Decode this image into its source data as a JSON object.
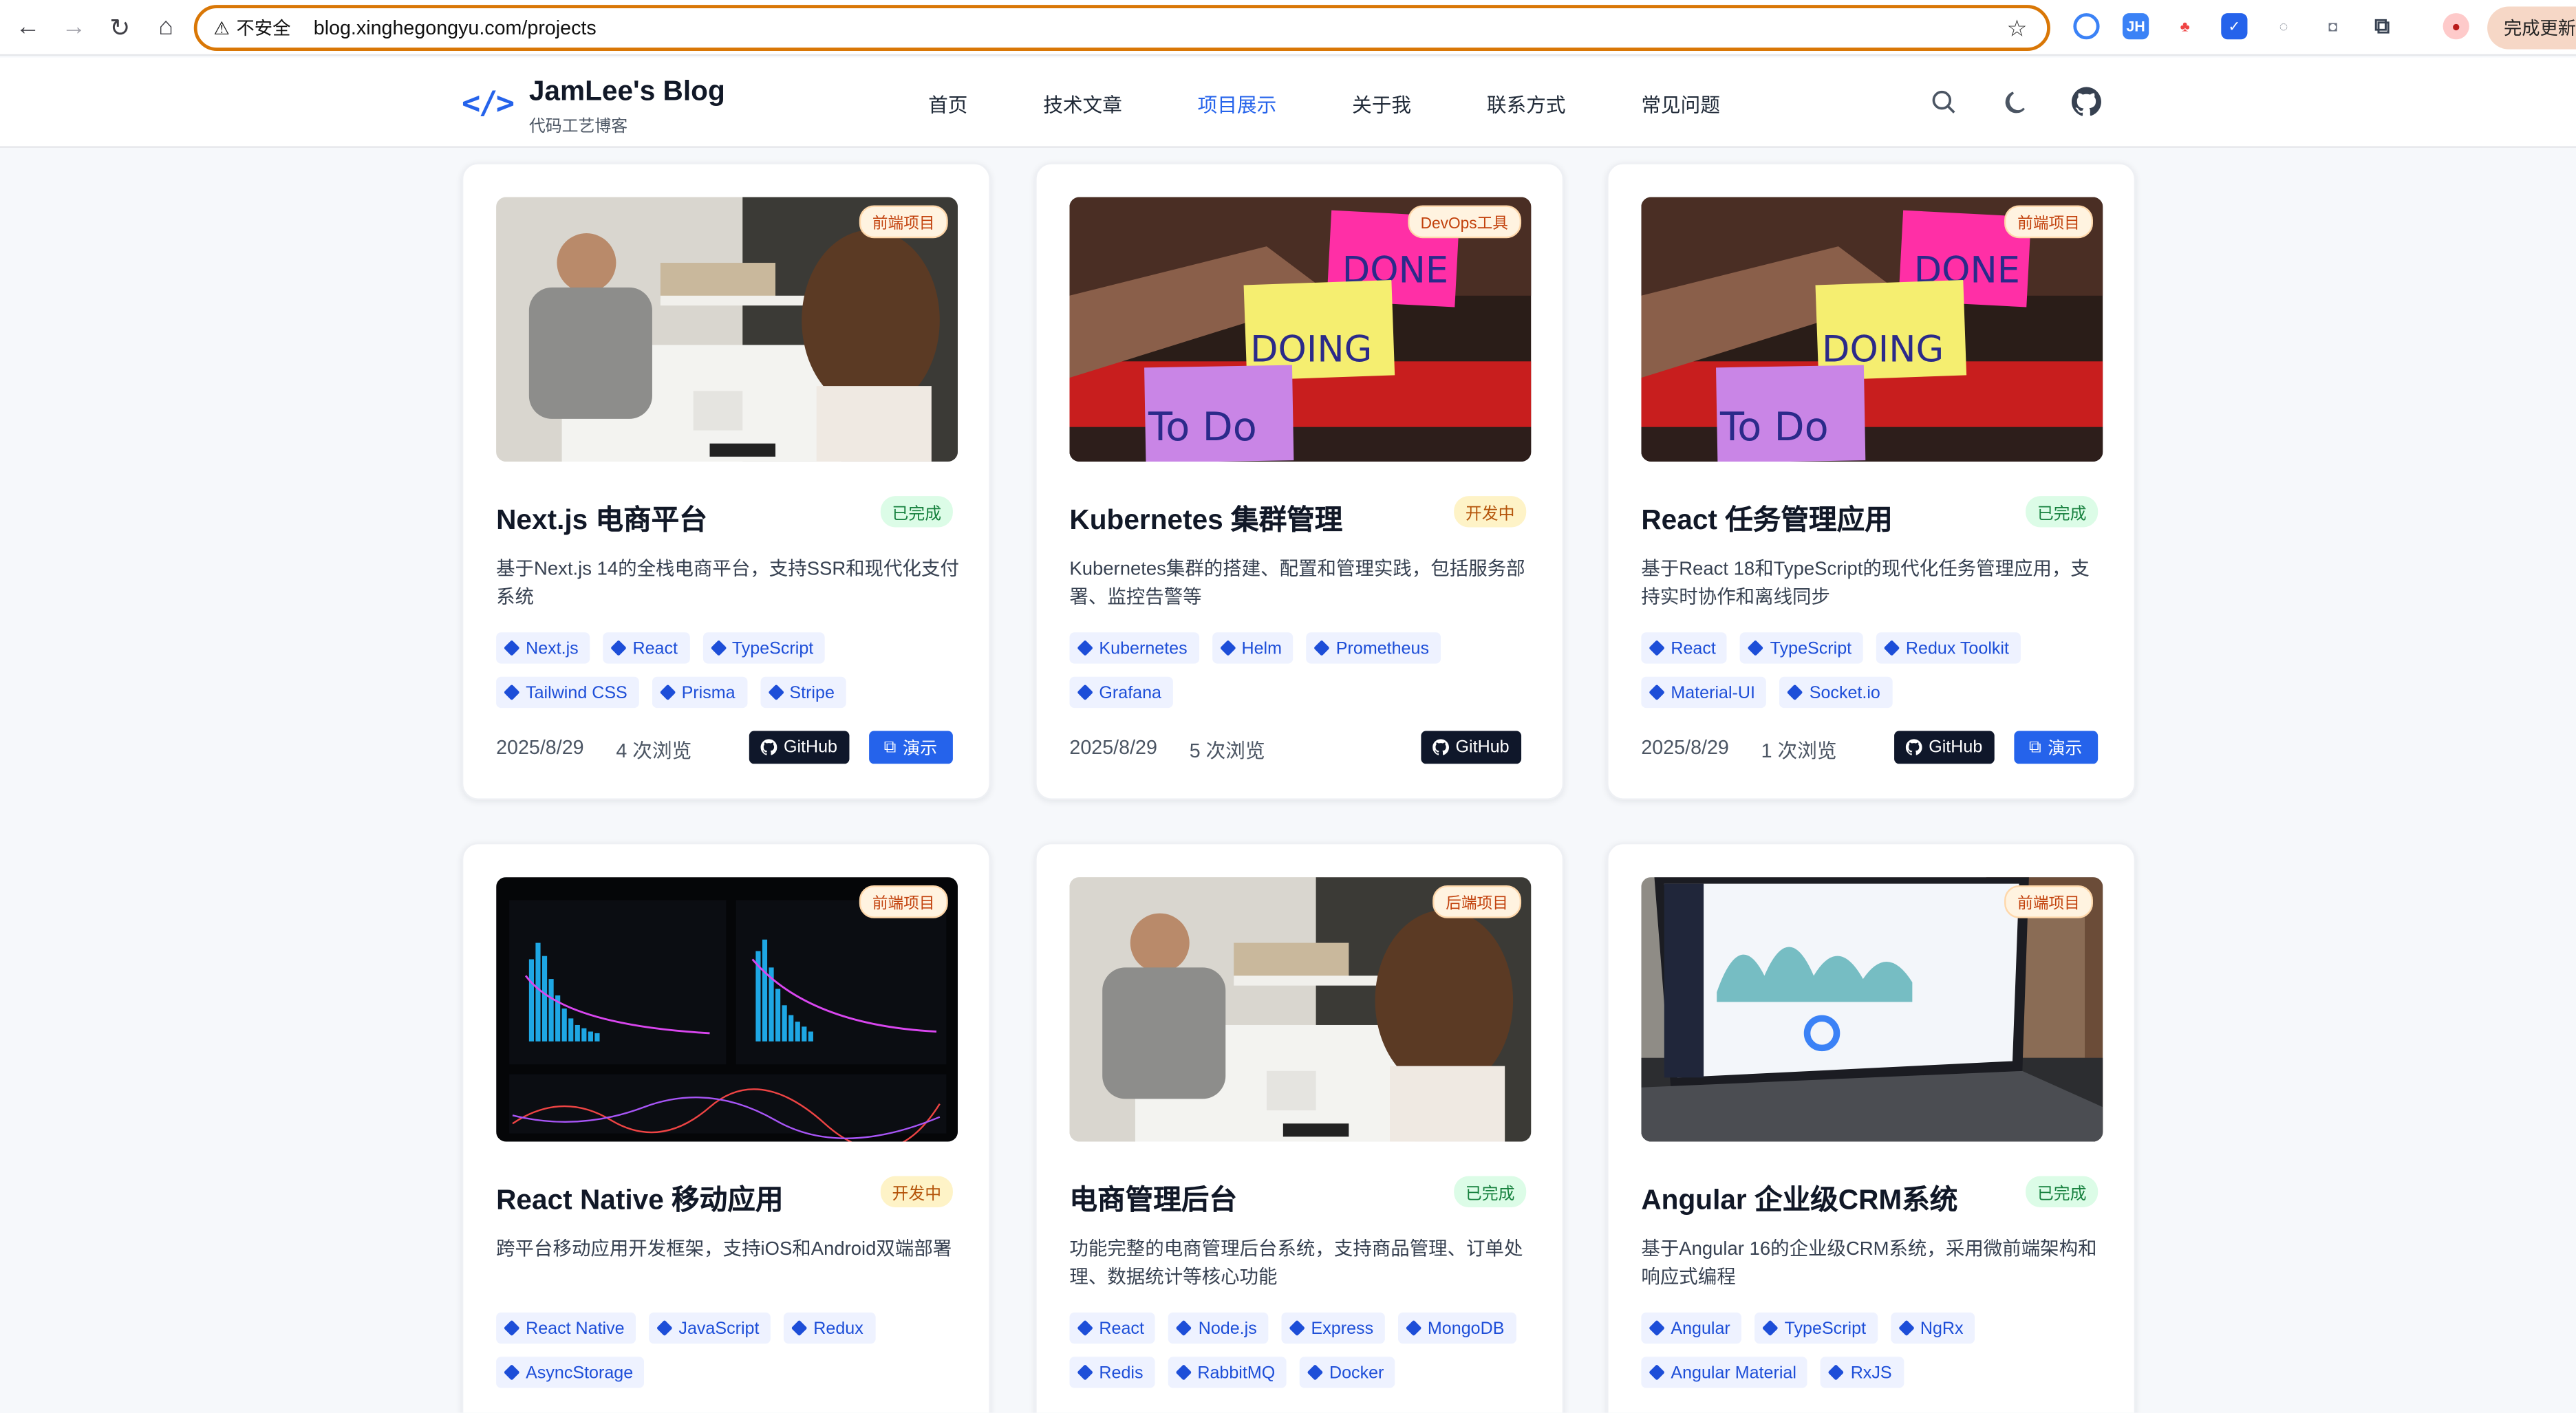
{
  "browser": {
    "insecure_label": "不安全",
    "url": "blog.xinghegongyu.com/projects",
    "update_label": "完成更新"
  },
  "site": {
    "logo_mark": "</>",
    "title": "JamLee's Blog",
    "subtitle": "代码工艺博客",
    "nav": [
      "首页",
      "技术文章",
      "项目展示",
      "关于我",
      "联系方式",
      "常见问题"
    ],
    "active_nav_index": 2,
    "accent": "#2563eb"
  },
  "projects": [
    {
      "category": "前端项目",
      "title": "Next.js 电商平台",
      "status": "已完成",
      "description": "基于Next.js 14的全栈电商平台，支持SSR和现代化支付系统",
      "tags": [
        "Next.js",
        "React",
        "TypeScript",
        "Tailwind CSS",
        "Prisma",
        "Stripe"
      ],
      "date": "2025/8/29",
      "views": "4 次浏览",
      "github_label": "GitHub",
      "demo_label": "演示",
      "image": "shop-photo"
    },
    {
      "category": "DevOps工具",
      "title": "Kubernetes 集群管理",
      "status": "开发中",
      "description": "Kubernetes集群的搭建、配置和管理实践，包括服务部署、监控告警等",
      "tags": [
        "Kubernetes",
        "Helm",
        "Prometheus",
        "Grafana"
      ],
      "date": "2025/8/29",
      "views": "5 次浏览",
      "github_label": "GitHub",
      "demo_label": "",
      "image": "kanban-photo"
    },
    {
      "category": "前端项目",
      "title": "React 任务管理应用",
      "status": "已完成",
      "description": "基于React 18和TypeScript的现代化任务管理应用，支持实时协作和离线同步",
      "tags": [
        "React",
        "TypeScript",
        "Redux Toolkit",
        "Material-UI",
        "Socket.io"
      ],
      "date": "2025/8/29",
      "views": "1 次浏览",
      "github_label": "GitHub",
      "demo_label": "演示",
      "image": "kanban-photo"
    },
    {
      "category": "前端项目",
      "title": "React Native 移动应用",
      "status": "开发中",
      "description": "跨平台移动应用开发框架，支持iOS和Android双端部署",
      "tags": [
        "React Native",
        "JavaScript",
        "Redux",
        "AsyncStorage"
      ],
      "image": "analytics-photo"
    },
    {
      "category": "后端项目",
      "title": "电商管理后台",
      "status": "已完成",
      "description": "功能完整的电商管理后台系统，支持商品管理、订单处理、数据统计等核心功能",
      "tags": [
        "React",
        "Node.js",
        "Express",
        "MongoDB",
        "Redis",
        "RabbitMQ",
        "Docker"
      ],
      "image": "shop-photo"
    },
    {
      "category": "前端项目",
      "title": "Angular 企业级CRM系统",
      "status": "已完成",
      "description": "基于Angular 16的企业级CRM系统，采用微前端架构和响应式编程",
      "tags": [
        "Angular",
        "TypeScript",
        "NgRx",
        "Angular Material",
        "RxJS"
      ],
      "image": "laptop-photo"
    }
  ],
  "sticky_notes": {
    "done": "DONE",
    "doing": "DOING",
    "todo": "To Do"
  },
  "colors": {
    "done_bg": "#dcfce7",
    "dev_bg": "#fef3c7",
    "tag_bg": "#eef2ff",
    "github_btn": "#0f172a"
  }
}
